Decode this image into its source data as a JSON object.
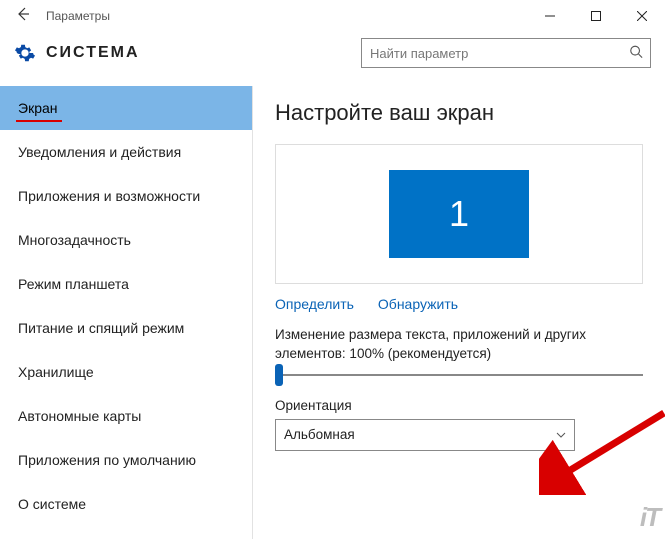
{
  "window": {
    "title": "Параметры"
  },
  "section": {
    "title": "СИСТЕМА"
  },
  "search": {
    "placeholder": "Найти параметр"
  },
  "sidebar": {
    "items": [
      {
        "label": "Экран",
        "active": true
      },
      {
        "label": "Уведомления и действия"
      },
      {
        "label": "Приложения и возможности"
      },
      {
        "label": "Многозадачность"
      },
      {
        "label": "Режим планшета"
      },
      {
        "label": "Питание и спящий режим"
      },
      {
        "label": "Хранилище"
      },
      {
        "label": "Автономные карты"
      },
      {
        "label": "Приложения по умолчанию"
      },
      {
        "label": "О системе"
      }
    ]
  },
  "main": {
    "heading": "Настройте ваш экран",
    "display_id": "1",
    "identify": "Определить",
    "detect": "Обнаружить",
    "scale_text": "Изменение размера текста, приложений и других элементов: 100% (рекомендуется)",
    "orientation_label": "Ориентация",
    "orientation_value": "Альбомная"
  },
  "watermark": "iT"
}
